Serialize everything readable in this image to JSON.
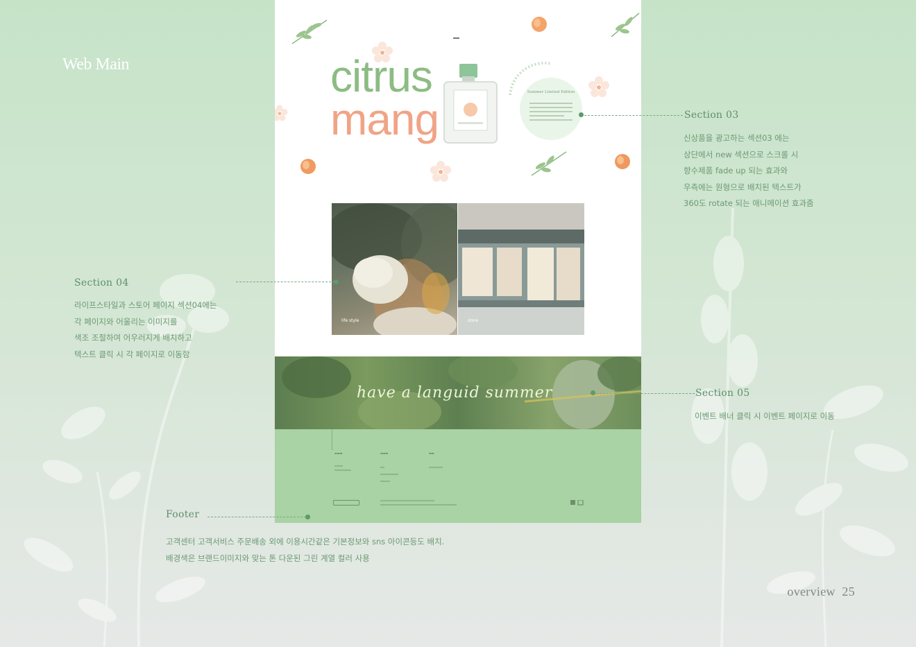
{
  "page": {
    "title": "Web Main",
    "page_label": "overview",
    "page_number": "25"
  },
  "mockup": {
    "hero": {
      "word_top": "citrus",
      "word_bottom": "mang",
      "badge_title": "Summer Limited Edition"
    },
    "photos": {
      "left_label": "life style",
      "right_label": "store"
    },
    "banner": {
      "text": "have a languid summer"
    }
  },
  "annotations": {
    "section03": {
      "title": "Section 03",
      "lines": [
        "신상품을 광고하는  섹션03 에는",
        "상단에서 new 섹션으로 스크롤 시",
        "향수제품 fade up 되는 효과와",
        "우측에는 원형으로 배치된 텍스트가",
        "360도 rotate 되는 애니메이션 효과줌"
      ]
    },
    "section04": {
      "title": "Section 04",
      "lines": [
        "라이프스타일과 스토어 페이지 섹션04에는",
        "각 페이지와 어울리는 이미지를",
        "색조 조절하여 어우러지게 배치하고",
        "텍스트 클릭 시 각 페이지로 이동함"
      ]
    },
    "section05": {
      "title": "Section 05",
      "lines": [
        "이벤트 배너 클릭 시 이벤트 페이지로 이동"
      ]
    },
    "footer": {
      "title": "Footer",
      "lines": [
        "고객센터 고객서비스 주문배송 외에  이용시간같은 기본정보와 sns 아이콘등도 배치.",
        "배경색은 브랜드이미지와 맞는 톤 다운된 그린 계열 컬러 사용"
      ]
    }
  },
  "colors": {
    "background_top": "#c6e3c8",
    "accent_green": "#5d8f6a",
    "citrus_green": "#8cbc83",
    "mango_peach": "#f0a486",
    "footer_green": "#a9d2a5"
  },
  "icons": [
    "leaf-icon",
    "peach-icon",
    "flower-icon",
    "perfume-bottle-icon",
    "sns-icon"
  ]
}
